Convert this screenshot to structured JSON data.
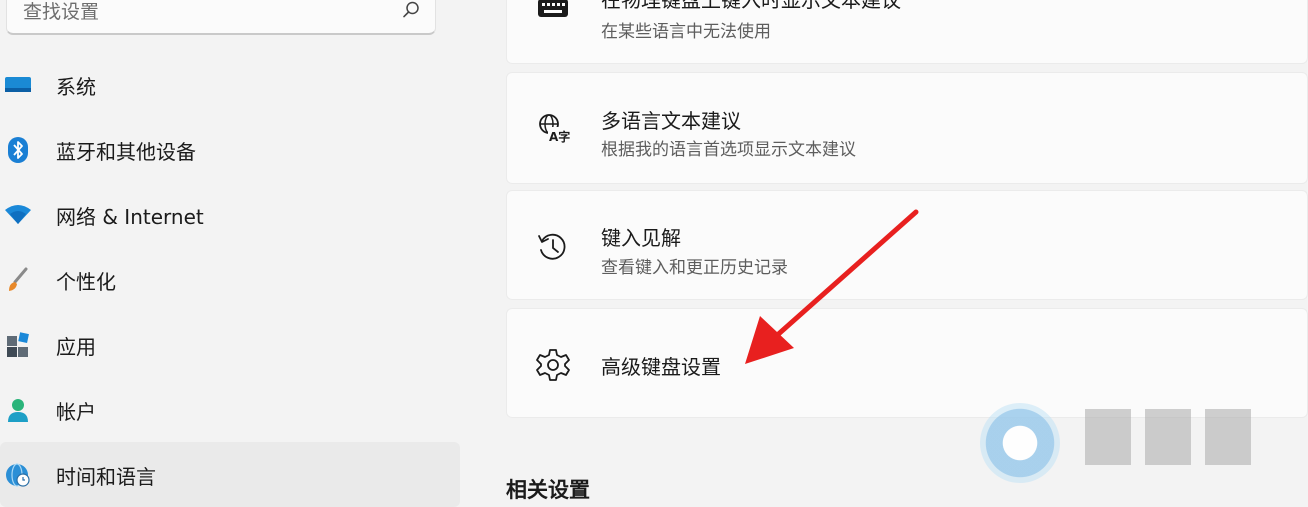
{
  "search": {
    "placeholder": "查找设置",
    "icon": "search-icon"
  },
  "sidebar": {
    "items": [
      {
        "label": "系统",
        "icon": "monitor-icon"
      },
      {
        "label": "蓝牙和其他设备",
        "icon": "bluetooth-icon"
      },
      {
        "label": "网络 & Internet",
        "icon": "wifi-icon"
      },
      {
        "label": "个性化",
        "icon": "brush-icon"
      },
      {
        "label": "应用",
        "icon": "apps-icon"
      },
      {
        "label": "帐户",
        "icon": "account-icon"
      },
      {
        "label": "时间和语言",
        "icon": "globe-clock-icon",
        "active": true
      }
    ]
  },
  "main": {
    "cards": [
      {
        "title": "在物理键盘上键入时显示文本建议",
        "subtitle": "在某些语言中无法使用",
        "icon": "keyboard-icon"
      },
      {
        "title": "多语言文本建议",
        "subtitle": "根据我的语言首选项显示文本建议",
        "icon": "translate-icon"
      },
      {
        "title": "键入见解",
        "subtitle": "查看键入和更正历史记录",
        "icon": "history-icon"
      },
      {
        "title": "高级键盘设置",
        "subtitle": "",
        "icon": "gear-icon"
      }
    ],
    "related_title": "相关设置"
  },
  "annotation": {
    "arrow_color": "#e8201f"
  },
  "colors": {
    "accent": "#0078d4",
    "background": "#f3f3f3",
    "card": "#fbfbfb"
  }
}
